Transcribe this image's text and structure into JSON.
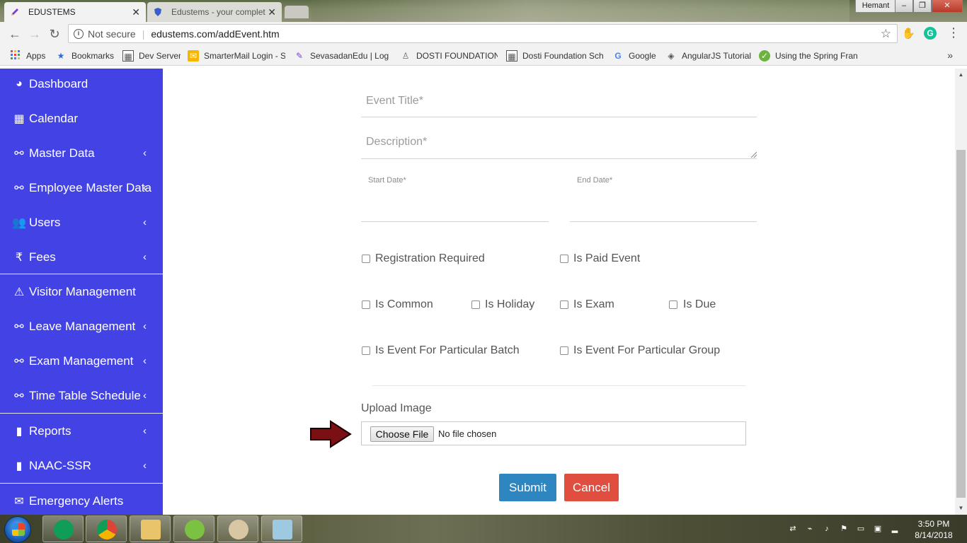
{
  "browser": {
    "tabs": [
      {
        "title": "EDUSTEMS",
        "active": true
      },
      {
        "title": "Edustems - your complet",
        "active": false
      }
    ],
    "window_user": "Hemant",
    "address": {
      "security_label": "Not secure",
      "url": "edustems.com/addEvent.htm"
    },
    "bookmarks": [
      {
        "label": "Apps",
        "icon": "apps-grid-icon"
      },
      {
        "label": "Bookmarks",
        "icon": "star-icon"
      },
      {
        "label": "Dev Server",
        "icon": "site-icon"
      },
      {
        "label": "SmarterMail Login - S",
        "icon": "mail-icon"
      },
      {
        "label": "SevasadanEdu | Log I",
        "icon": "pencil-icon"
      },
      {
        "label": "DOSTI FOUNDATION",
        "icon": "lock-icon"
      },
      {
        "label": "Dosti Foundation Sch",
        "icon": "site-icon"
      },
      {
        "label": "Google",
        "icon": "google-icon"
      },
      {
        "label": "AngularJS Tutorial",
        "icon": "angular-icon"
      },
      {
        "label": "Using the Spring Fran",
        "icon": "spring-icon"
      }
    ],
    "more_label": "»"
  },
  "sidebar": {
    "items": [
      {
        "label": "Dashboard",
        "icon": "dashboard-icon",
        "has_submenu": false
      },
      {
        "label": "Calendar",
        "icon": "calendar-icon",
        "has_submenu": false
      },
      {
        "label": "Master Data",
        "icon": "link-icon",
        "has_submenu": true
      },
      {
        "label": "Employee Master Data",
        "icon": "link-icon",
        "has_submenu": true
      },
      {
        "label": "Users",
        "icon": "users-icon",
        "has_submenu": true
      },
      {
        "label": "Fees",
        "icon": "rupee-icon",
        "has_submenu": true
      },
      {
        "label": "Visitor Management",
        "icon": "warning-icon",
        "has_submenu": false
      },
      {
        "label": "Leave Management",
        "icon": "link-icon",
        "has_submenu": true
      },
      {
        "label": "Exam Management",
        "icon": "link-icon",
        "has_submenu": true
      },
      {
        "label": "Time Table Schedule",
        "icon": "link-icon",
        "has_submenu": true
      },
      {
        "label": "Reports",
        "icon": "file-icon",
        "has_submenu": true
      },
      {
        "label": "NAAC-SSR",
        "icon": "file-icon",
        "has_submenu": true
      },
      {
        "label": "Emergency Alerts",
        "icon": "envelope-icon",
        "has_submenu": false
      }
    ]
  },
  "form": {
    "event_title_placeholder": "Event Title*",
    "description_placeholder": "Description*",
    "start_date_label": "Start Date*",
    "end_date_label": "End Date*",
    "checkboxes": {
      "registration_required": "Registration Required",
      "is_paid_event": "Is Paid Event",
      "is_common": "Is Common",
      "is_holiday": "Is Holiday",
      "is_exam": "Is Exam",
      "is_due": "Is Due",
      "is_event_for_particular_batch": "Is Event For Particular Batch",
      "is_event_for_particular_group": "Is Event For Particular Group"
    },
    "upload_label": "Upload Image",
    "choose_file_label": "Choose File",
    "no_file_text": "No file chosen",
    "submit_label": "Submit",
    "cancel_label": "Cancel"
  },
  "taskbar": {
    "time": "3:50 PM",
    "date": "8/14/2018"
  },
  "colors": {
    "sidebar_bg": "#4343e5",
    "submit_bg": "#2e86c1",
    "cancel_bg": "#e04e3f",
    "arrow_fill": "#7a0f14"
  }
}
